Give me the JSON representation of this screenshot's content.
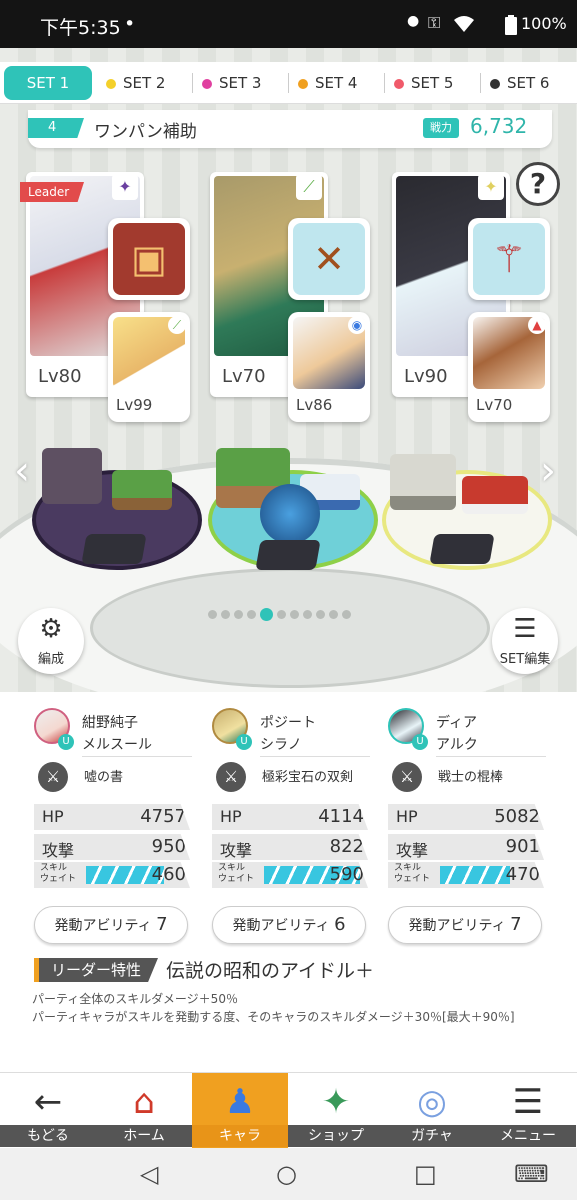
{
  "status_bar": {
    "time": "下午5:35",
    "dot": "•",
    "battery": "100%"
  },
  "tabs": [
    {
      "label": "SET 1",
      "color": "#2fc3b8",
      "active": true
    },
    {
      "label": "SET 2",
      "color": "#f4d02a"
    },
    {
      "label": "SET 3",
      "color": "#e040a0"
    },
    {
      "label": "SET 4",
      "color": "#f0a020"
    },
    {
      "label": "SET 5",
      "color": "#f05a6a"
    },
    {
      "label": "SET 6",
      "color": "#333333"
    }
  ],
  "team": {
    "number": "4",
    "name": "ワンパン補助",
    "power_label": "戦力",
    "power": "6,732"
  },
  "cards": [
    {
      "leader": "Leader",
      "level": "Lv80",
      "sub_level": "Lv99",
      "attr_icon": "✦"
    },
    {
      "level": "Lv70",
      "sub_level": "Lv86",
      "attr_icon": "⟋"
    },
    {
      "level": "Lv90",
      "sub_level": "Lv70",
      "attr_icon": "✦"
    }
  ],
  "buttons": {
    "formation": "編成",
    "set_edit": "SET編集",
    "help": "?"
  },
  "characters": [
    {
      "name": "紺野純子",
      "unit": "メルスール",
      "weapon": "嘘の書",
      "hp": "4757",
      "atk": "950",
      "skill_wait": "460",
      "ability": "発動アビリティ",
      "ability_count": "7"
    },
    {
      "name": "ポジート",
      "unit": "シラノ",
      "weapon": "極彩宝石の双剣",
      "hp": "4114",
      "atk": "822",
      "skill_wait": "590",
      "ability": "発動アビリティ",
      "ability_count": "6"
    },
    {
      "name": "ディア",
      "unit": "アルク",
      "weapon": "戦士の棍棒",
      "hp": "5082",
      "atk": "901",
      "skill_wait": "470",
      "ability": "発動アビリティ",
      "ability_count": "7"
    }
  ],
  "labels": {
    "hp": "HP",
    "atk": "攻撃",
    "skill1": "スキル",
    "skill2": "ウェイト"
  },
  "leader_skill": {
    "tag": "リーダー特性",
    "name": "伝説の昭和のアイドル＋",
    "line1": "パーティ全体のスキルダメージ＋50％",
    "line2": "パーティキャラがスキルを発動する度、そのキャラのスキルダメージ＋30％[最大＋90％]"
  },
  "nav": [
    {
      "label": "もどる",
      "icon": "←"
    },
    {
      "label": "ホーム",
      "icon": "⌂"
    },
    {
      "label": "キャラ",
      "icon": "♟",
      "active": true
    },
    {
      "label": "ショップ",
      "icon": "💰"
    },
    {
      "label": "ガチャ",
      "icon": "◎"
    },
    {
      "label": "メニュー",
      "icon": "☰"
    }
  ]
}
